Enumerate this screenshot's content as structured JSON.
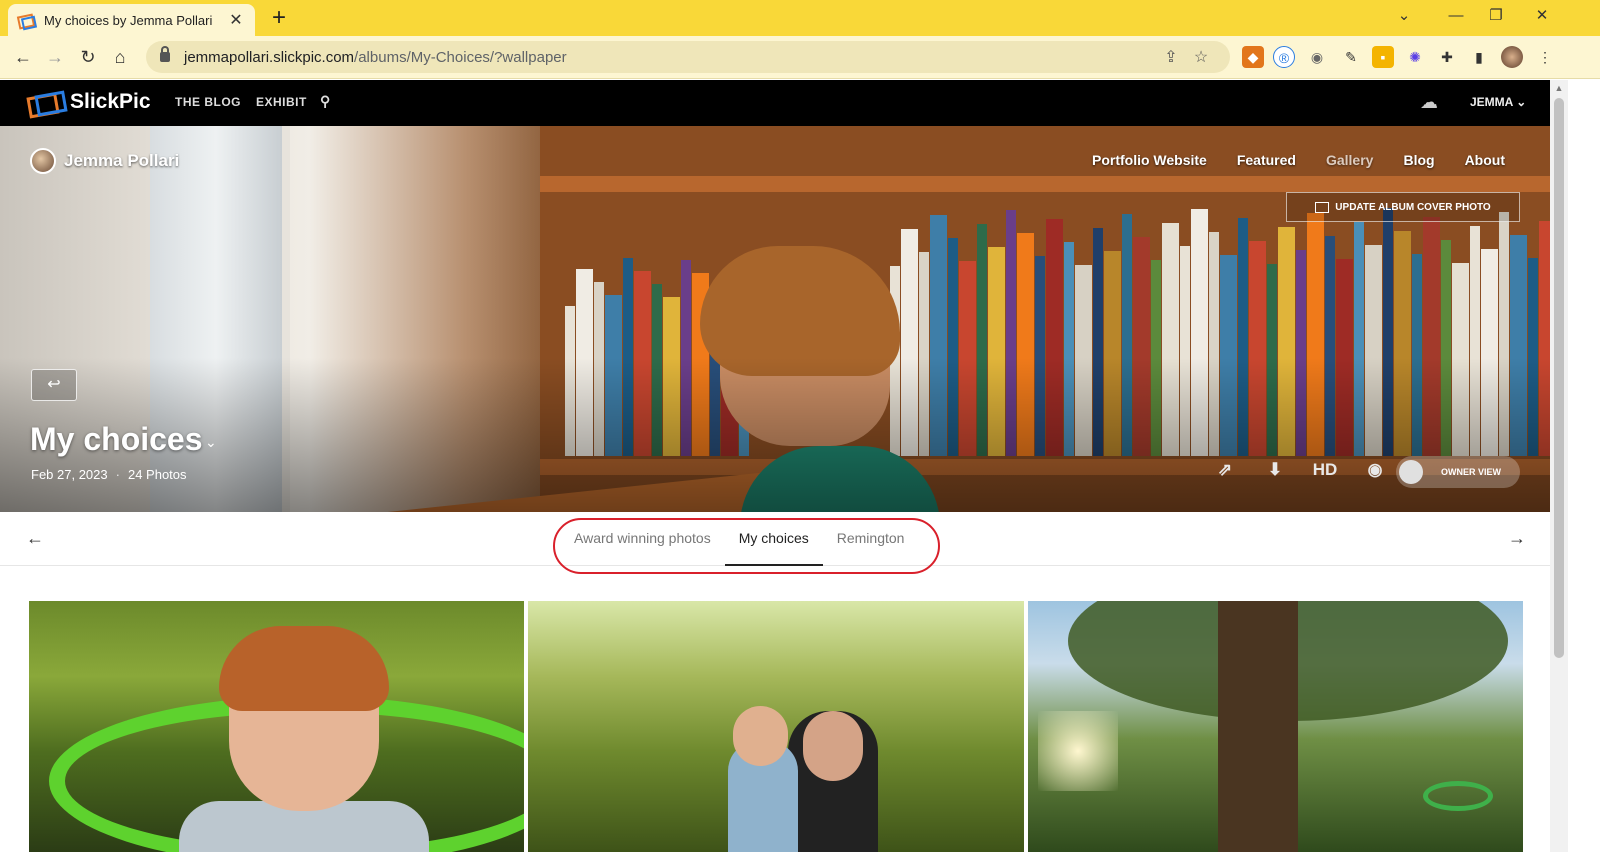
{
  "browser": {
    "tab_title": "My choices by Jemma Pollari",
    "tab_close": "✕",
    "new_tab": "+",
    "url_host": "jemmapollari.slickpic.com",
    "url_path": "/albums/My-Choices/?wallpaper",
    "window_controls": {
      "collapse": "⌄",
      "minimize": "—",
      "restore": "❐",
      "close": "✕"
    }
  },
  "site_nav": {
    "brand": "SlickPic",
    "links": [
      "THE BLOG",
      "EXHIBIT"
    ],
    "user_label": "JEMMA ⌄"
  },
  "hero": {
    "owner_name": "Jemma Pollari",
    "menu": [
      "Portfolio Website",
      "Featured",
      "Gallery",
      "Blog",
      "About"
    ],
    "active_menu_index": 2,
    "update_cover_label": "UPDATE ALBUM COVER PHOTO",
    "album_title": "My choices",
    "album_date": "Feb 27, 2023",
    "album_count": "24 Photos",
    "hd_label": "HD",
    "owner_view_label": "OWNER VIEW"
  },
  "album_tabs": {
    "items": [
      "Award winning photos",
      "My choices",
      "Remington"
    ],
    "active_index": 1,
    "highlight_color": "#d9202b"
  },
  "colors": {
    "chrome_yellow": "#f9d838",
    "nav_black": "#000000",
    "brand_orange": "#e77b2c",
    "brand_blue": "#2a7de1"
  }
}
